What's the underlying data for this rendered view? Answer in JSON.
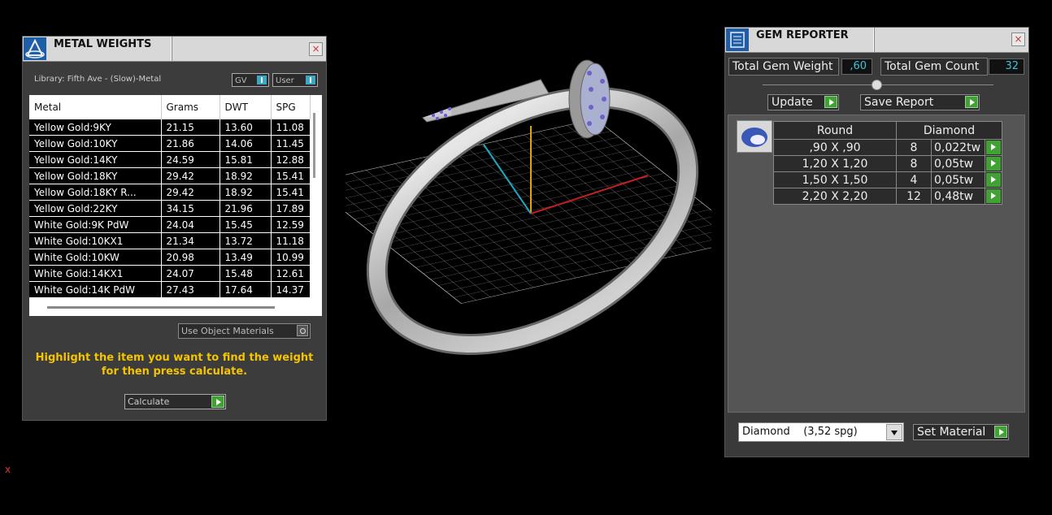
{
  "metal_weights": {
    "title": "METAL WEIGHTS",
    "close": "×",
    "library_label": "Library: Fifth Ave - (Slow)-Metal",
    "toggle_gv": "GV",
    "toggle_user": "User",
    "columns": [
      "Metal",
      "Grams",
      "DWT",
      "SPG"
    ],
    "rows": [
      [
        "Yellow Gold:9KY",
        "21.15",
        "13.60",
        "11.08"
      ],
      [
        "Yellow Gold:10KY",
        "21.86",
        "14.06",
        "11.45"
      ],
      [
        "Yellow Gold:14KY",
        "24.59",
        "15.81",
        "12.88"
      ],
      [
        "Yellow Gold:18KY",
        "29.42",
        "18.92",
        "15.41"
      ],
      [
        "Yellow Gold:18KY R...",
        "29.42",
        "18.92",
        "15.41"
      ],
      [
        "Yellow Gold:22KY",
        "34.15",
        "21.96",
        "17.89"
      ],
      [
        "White Gold:9K PdW",
        "24.04",
        "15.45",
        "12.59"
      ],
      [
        "White Gold:10KX1",
        "21.34",
        "13.72",
        "11.18"
      ],
      [
        "White Gold:10KW",
        "20.98",
        "13.49",
        "10.99"
      ],
      [
        "White Gold:14KX1",
        "24.07",
        "15.48",
        "12.61"
      ],
      [
        "White Gold:14K PdW",
        "27.43",
        "17.64",
        "14.37"
      ]
    ],
    "use_object_materials": "Use Object Materials",
    "hint_line1": "Highlight the item you want to find the weight",
    "hint_line2": "for then press calculate.",
    "calculate": "Calculate"
  },
  "gem_reporter": {
    "title": "GEM REPORTER",
    "close": "×",
    "total_weight_label": "Total Gem Weight",
    "total_weight_value": ",60",
    "total_count_label": "Total Gem Count",
    "total_count_value": "32",
    "update": "Update",
    "save_report": "Save Report",
    "gem_shape": "Round",
    "gem_material": "Diamond",
    "gems": [
      {
        "size": ",90 X ,90",
        "count": "8",
        "weight": "0,022tw"
      },
      {
        "size": "1,20 X 1,20",
        "count": "8",
        "weight": "0,05tw"
      },
      {
        "size": "1,50 X 1,50",
        "count": "4",
        "weight": "0,05tw"
      },
      {
        "size": "2,20 X 2,20",
        "count": "12",
        "weight": "0,48tw"
      }
    ],
    "material_select": "Diamond    (3,52 spg)",
    "set_material": "Set Material"
  },
  "axis_label": "x",
  "colors": {
    "accent_green": "#3fa232",
    "value_cyan": "#3bc4d8",
    "hint_yellow": "#f5c400"
  }
}
